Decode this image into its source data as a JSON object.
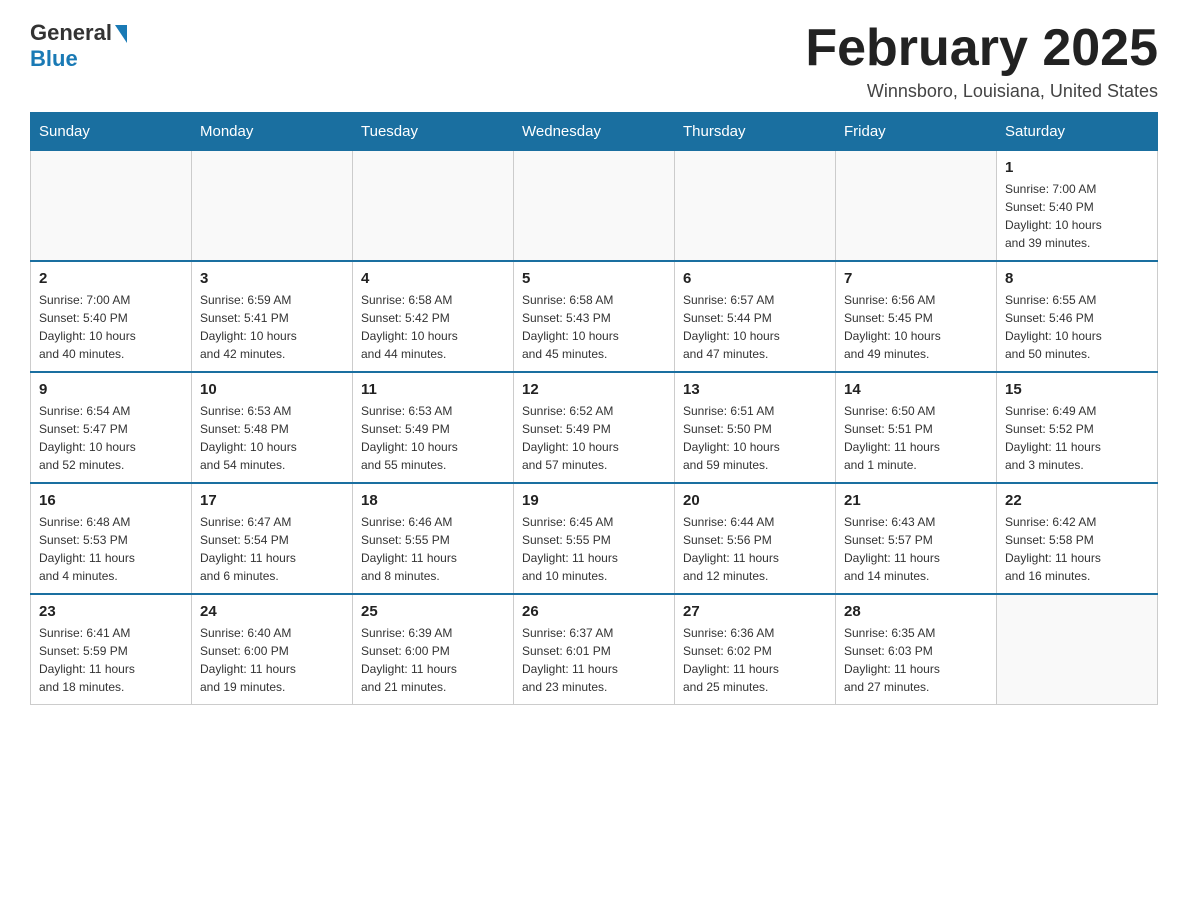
{
  "header": {
    "logo_top": "General",
    "logo_bottom": "Blue",
    "month_title": "February 2025",
    "location": "Winnsboro, Louisiana, United States"
  },
  "days_of_week": [
    "Sunday",
    "Monday",
    "Tuesday",
    "Wednesday",
    "Thursday",
    "Friday",
    "Saturday"
  ],
  "weeks": [
    {
      "days": [
        {
          "number": "",
          "info": ""
        },
        {
          "number": "",
          "info": ""
        },
        {
          "number": "",
          "info": ""
        },
        {
          "number": "",
          "info": ""
        },
        {
          "number": "",
          "info": ""
        },
        {
          "number": "",
          "info": ""
        },
        {
          "number": "1",
          "info": "Sunrise: 7:00 AM\nSunset: 5:40 PM\nDaylight: 10 hours\nand 39 minutes."
        }
      ]
    },
    {
      "days": [
        {
          "number": "2",
          "info": "Sunrise: 7:00 AM\nSunset: 5:40 PM\nDaylight: 10 hours\nand 40 minutes."
        },
        {
          "number": "3",
          "info": "Sunrise: 6:59 AM\nSunset: 5:41 PM\nDaylight: 10 hours\nand 42 minutes."
        },
        {
          "number": "4",
          "info": "Sunrise: 6:58 AM\nSunset: 5:42 PM\nDaylight: 10 hours\nand 44 minutes."
        },
        {
          "number": "5",
          "info": "Sunrise: 6:58 AM\nSunset: 5:43 PM\nDaylight: 10 hours\nand 45 minutes."
        },
        {
          "number": "6",
          "info": "Sunrise: 6:57 AM\nSunset: 5:44 PM\nDaylight: 10 hours\nand 47 minutes."
        },
        {
          "number": "7",
          "info": "Sunrise: 6:56 AM\nSunset: 5:45 PM\nDaylight: 10 hours\nand 49 minutes."
        },
        {
          "number": "8",
          "info": "Sunrise: 6:55 AM\nSunset: 5:46 PM\nDaylight: 10 hours\nand 50 minutes."
        }
      ]
    },
    {
      "days": [
        {
          "number": "9",
          "info": "Sunrise: 6:54 AM\nSunset: 5:47 PM\nDaylight: 10 hours\nand 52 minutes."
        },
        {
          "number": "10",
          "info": "Sunrise: 6:53 AM\nSunset: 5:48 PM\nDaylight: 10 hours\nand 54 minutes."
        },
        {
          "number": "11",
          "info": "Sunrise: 6:53 AM\nSunset: 5:49 PM\nDaylight: 10 hours\nand 55 minutes."
        },
        {
          "number": "12",
          "info": "Sunrise: 6:52 AM\nSunset: 5:49 PM\nDaylight: 10 hours\nand 57 minutes."
        },
        {
          "number": "13",
          "info": "Sunrise: 6:51 AM\nSunset: 5:50 PM\nDaylight: 10 hours\nand 59 minutes."
        },
        {
          "number": "14",
          "info": "Sunrise: 6:50 AM\nSunset: 5:51 PM\nDaylight: 11 hours\nand 1 minute."
        },
        {
          "number": "15",
          "info": "Sunrise: 6:49 AM\nSunset: 5:52 PM\nDaylight: 11 hours\nand 3 minutes."
        }
      ]
    },
    {
      "days": [
        {
          "number": "16",
          "info": "Sunrise: 6:48 AM\nSunset: 5:53 PM\nDaylight: 11 hours\nand 4 minutes."
        },
        {
          "number": "17",
          "info": "Sunrise: 6:47 AM\nSunset: 5:54 PM\nDaylight: 11 hours\nand 6 minutes."
        },
        {
          "number": "18",
          "info": "Sunrise: 6:46 AM\nSunset: 5:55 PM\nDaylight: 11 hours\nand 8 minutes."
        },
        {
          "number": "19",
          "info": "Sunrise: 6:45 AM\nSunset: 5:55 PM\nDaylight: 11 hours\nand 10 minutes."
        },
        {
          "number": "20",
          "info": "Sunrise: 6:44 AM\nSunset: 5:56 PM\nDaylight: 11 hours\nand 12 minutes."
        },
        {
          "number": "21",
          "info": "Sunrise: 6:43 AM\nSunset: 5:57 PM\nDaylight: 11 hours\nand 14 minutes."
        },
        {
          "number": "22",
          "info": "Sunrise: 6:42 AM\nSunset: 5:58 PM\nDaylight: 11 hours\nand 16 minutes."
        }
      ]
    },
    {
      "days": [
        {
          "number": "23",
          "info": "Sunrise: 6:41 AM\nSunset: 5:59 PM\nDaylight: 11 hours\nand 18 minutes."
        },
        {
          "number": "24",
          "info": "Sunrise: 6:40 AM\nSunset: 6:00 PM\nDaylight: 11 hours\nand 19 minutes."
        },
        {
          "number": "25",
          "info": "Sunrise: 6:39 AM\nSunset: 6:00 PM\nDaylight: 11 hours\nand 21 minutes."
        },
        {
          "number": "26",
          "info": "Sunrise: 6:37 AM\nSunset: 6:01 PM\nDaylight: 11 hours\nand 23 minutes."
        },
        {
          "number": "27",
          "info": "Sunrise: 6:36 AM\nSunset: 6:02 PM\nDaylight: 11 hours\nand 25 minutes."
        },
        {
          "number": "28",
          "info": "Sunrise: 6:35 AM\nSunset: 6:03 PM\nDaylight: 11 hours\nand 27 minutes."
        },
        {
          "number": "",
          "info": ""
        }
      ]
    }
  ]
}
